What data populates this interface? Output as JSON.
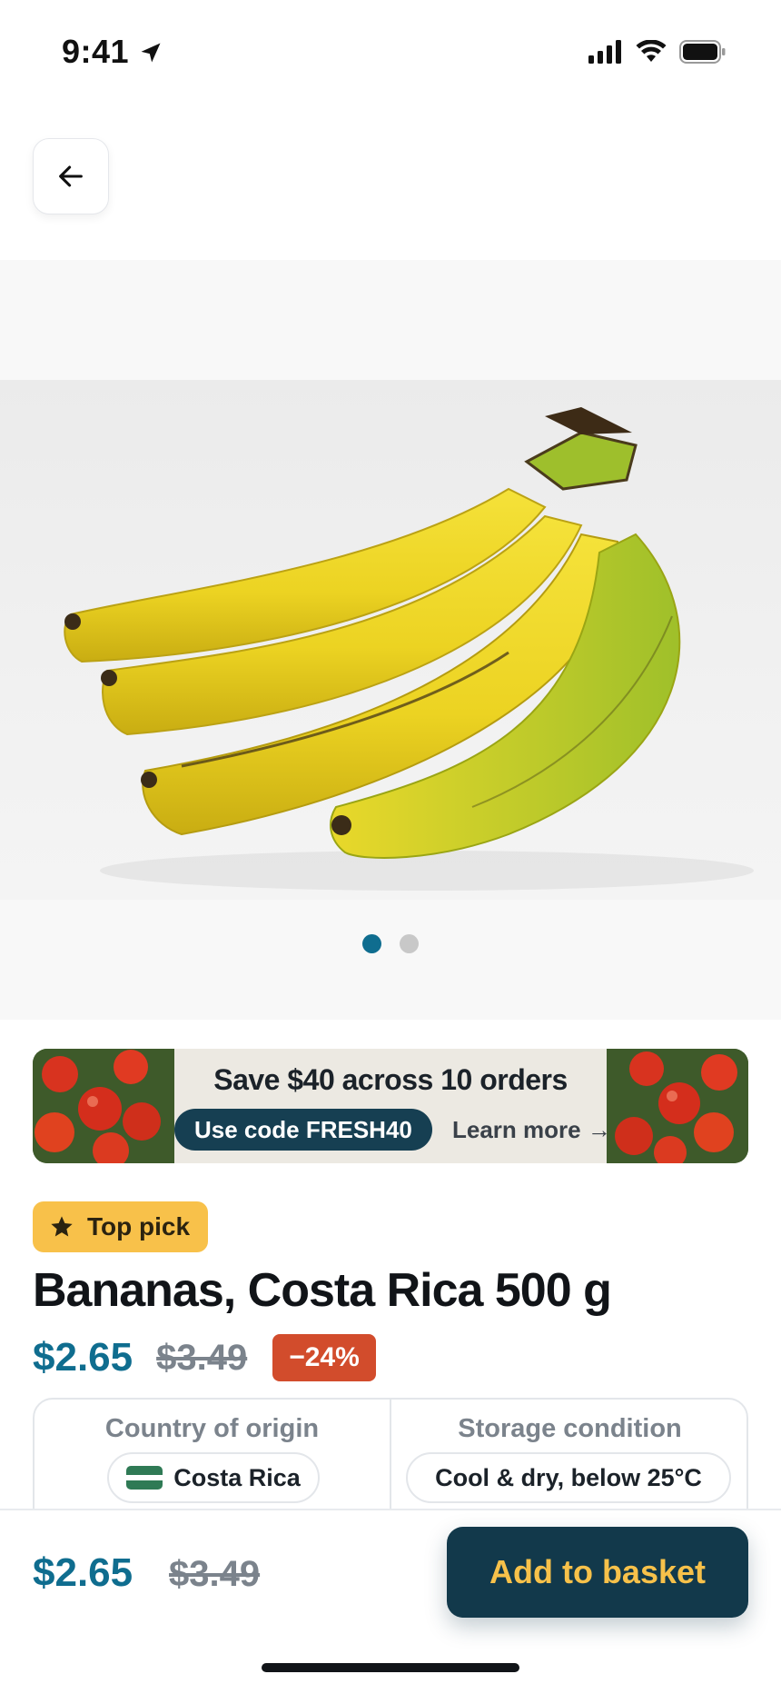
{
  "status_bar": {
    "time": "9:41",
    "icons": [
      "location-arrow-icon",
      "cellular-signal-icon",
      "wifi-icon",
      "battery-icon"
    ]
  },
  "navigation": {
    "back_icon": "arrow-left-icon"
  },
  "gallery": {
    "image_subject": "bananas",
    "page_count": 2,
    "active_page": 1,
    "active_color": "#0f6d8f"
  },
  "promo": {
    "title": "Save $40 across 10 orders",
    "code_label": "Use code FRESH40",
    "learn_more": "Learn more →",
    "side_image_subject": "tomatoes"
  },
  "product": {
    "badge": {
      "icon": "star-icon",
      "label": "Top pick",
      "color": "#f8c14a"
    },
    "title": "Bananas, Costa Rica 500 g",
    "price": "$2.65",
    "old_price": "$3.49",
    "discount": "−24%",
    "discount_color": "#d24c2c",
    "specs": [
      {
        "label": "Country of origin",
        "value": "Costa Rica",
        "icon": "costa-rica-flag-icon"
      },
      {
        "label": "Storage condition",
        "value": "Cool & dry, below 25°C"
      }
    ]
  },
  "bottom_bar": {
    "price": "$2.65",
    "old_price": "$3.49",
    "cta_label": "Add to basket",
    "cta_color": "#12394b",
    "cta_text_color": "#f7c14a"
  },
  "colors": {
    "accent": "#0f6d8f",
    "dark": "#12394b",
    "gold": "#f8c14a"
  }
}
